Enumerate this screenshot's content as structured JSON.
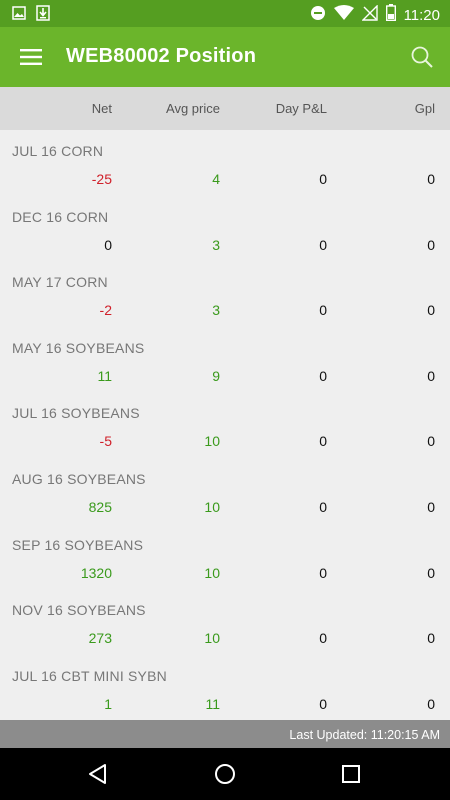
{
  "status_bar": {
    "time": "11:20",
    "icons": [
      "image-icon",
      "download-icon",
      "dnd-icon",
      "wifi-icon",
      "signal-off-icon",
      "battery-icon"
    ]
  },
  "app_bar": {
    "title": "WEB80002 Position",
    "menu_icon": "menu-icon",
    "search_icon": "search-icon"
  },
  "columns": {
    "net": "Net",
    "avg_price": "Avg price",
    "day_pl": "Day P&L",
    "gpl": "Gpl"
  },
  "rows": [
    {
      "name": "JUL 16 CORN",
      "net": "-25",
      "avg_price": "4",
      "day_pl": "0",
      "gpl": "0"
    },
    {
      "name": "DEC 16 CORN",
      "net": "0",
      "avg_price": "3",
      "day_pl": "0",
      "gpl": "0"
    },
    {
      "name": "MAY 17 CORN",
      "net": "-2",
      "avg_price": "3",
      "day_pl": "0",
      "gpl": "0"
    },
    {
      "name": "MAY 16 SOYBEANS",
      "net": "11",
      "avg_price": "9",
      "day_pl": "0",
      "gpl": "0"
    },
    {
      "name": "JUL 16 SOYBEANS",
      "net": "-5",
      "avg_price": "10",
      "day_pl": "0",
      "gpl": "0"
    },
    {
      "name": "AUG 16 SOYBEANS",
      "net": "825",
      "avg_price": "10",
      "day_pl": "0",
      "gpl": "0"
    },
    {
      "name": "SEP 16 SOYBEANS",
      "net": "1320",
      "avg_price": "10",
      "day_pl": "0",
      "gpl": "0"
    },
    {
      "name": "NOV 16 SOYBEANS",
      "net": "273",
      "avg_price": "10",
      "day_pl": "0",
      "gpl": "0"
    },
    {
      "name": "JUL 16 CBT MINI SYBN",
      "net": "1",
      "avg_price": "11",
      "day_pl": "0",
      "gpl": "0"
    }
  ],
  "footer": {
    "last_updated": "Last Updated: 11:20:15 AM"
  },
  "colors": {
    "app_bar": "#6bb52b",
    "status_bar": "#559e21",
    "negative": "#d0202a",
    "positive": "#3a9a1c"
  },
  "nav_bar": {
    "icons": [
      "back-icon",
      "home-icon",
      "recents-icon"
    ]
  }
}
